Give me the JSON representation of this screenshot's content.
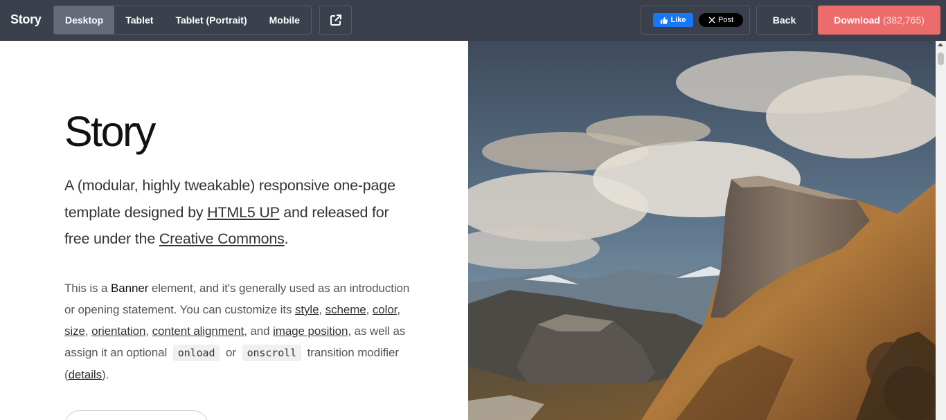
{
  "topbar": {
    "brand": "Story",
    "devices": [
      "Desktop",
      "Tablet",
      "Tablet (Portrait)",
      "Mobile"
    ],
    "active_device": "Desktop",
    "external_icon": "external-link-icon",
    "like_label": "Like",
    "post_label": "Post",
    "back_label": "Back",
    "download_label": "Download",
    "download_count": "(382,765)",
    "colors": {
      "bar": "#3a404c",
      "active": "#646b79",
      "download": "#ec6b6b",
      "facebook": "#1877f2"
    }
  },
  "banner": {
    "title": "Story",
    "lead": {
      "before_link1": "A (modular, highly tweakable) responsive one-page template designed by ",
      "link1": "HTML5 UP",
      "between": " and released for free under the ",
      "link2": "Creative Commons",
      "after": "."
    },
    "body": {
      "t1": "This is a ",
      "strong": "Banner",
      "t2": " element, and it's generally used as an introduction or opening statement. You can customize its ",
      "l_style": "style",
      "l_scheme": "scheme",
      "l_color": "color",
      "l_size": "size",
      "l_orientation": "orientation",
      "l_alignment": "content alignment",
      "t3": ", and ",
      "l_image": "image position",
      "t4": ", as well as assign it an optional ",
      "code1": "onload",
      "t5": " or ",
      "code2": "onscroll",
      "t6": " transition modifier (",
      "l_details": "details",
      "t7": ")."
    }
  }
}
